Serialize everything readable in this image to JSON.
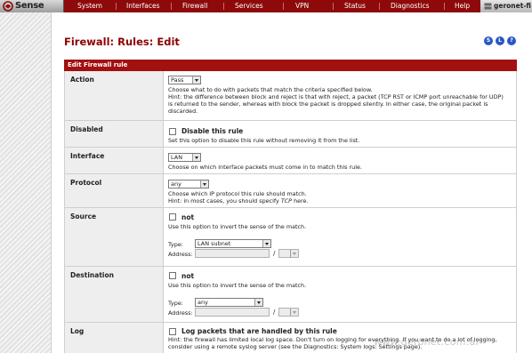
{
  "app": {
    "logo_text": "Sense",
    "hostname": "geronet-fi"
  },
  "nav": [
    "System",
    "Interfaces",
    "Firewall",
    "Services",
    "VPN",
    "Status",
    "Diagnostics",
    "Help"
  ],
  "page": {
    "title": "Firewall: Rules: Edit",
    "icons": [
      {
        "name": "status-icon",
        "letter": "S"
      },
      {
        "name": "log-icon",
        "letter": "L"
      },
      {
        "name": "help-icon",
        "letter": "?"
      }
    ]
  },
  "form": {
    "header": "Edit Firewall rule",
    "action": {
      "label": "Action",
      "value": "Pass",
      "desc": "Choose what to do with packets that match the criteria specified below.",
      "hint1": "Hint: the difference between block and reject is that with reject, a packet (TCP RST or ICMP port unreachable for UDP)",
      "hint2": "is returned to the sender, whereas with block the packet is dropped silently. In either case, the original packet is",
      "hint3": "discarded."
    },
    "disabled": {
      "label": "Disabled",
      "checkbox_label": "Disable this rule",
      "desc": "Set this option to disable this rule without removing it from the list."
    },
    "interface": {
      "label": "Interface",
      "value": "LAN",
      "desc": "Choose on which interface packets must come in to match this rule."
    },
    "protocol": {
      "label": "Protocol",
      "value": "any",
      "desc": "Choose which IP protocol this rule should match.",
      "hint_prefix": "Hint: in most cases, you should specify ",
      "hint_em": "TCP",
      "hint_suffix": " here."
    },
    "source": {
      "label": "Source",
      "not_label": "not",
      "desc": "Use this option to invert the sense of the match.",
      "type_label": "Type:",
      "type_value": "LAN subnet",
      "address_label": "Address:",
      "slash": "/"
    },
    "destination": {
      "label": "Destination",
      "not_label": "not",
      "desc": "Use this option to invert the sense of the match.",
      "type_label": "Type:",
      "type_value": "any",
      "address_label": "Address:",
      "slash": "/"
    },
    "log": {
      "label": "Log",
      "checkbox_label": "Log packets that are handled by this rule",
      "hint1": "Hint: the firewall has limited local log space. Don't turn on logging for everything. If you want to do a lot of logging,",
      "hint2": "consider using a remote syslog server (see the Diagnostics: System logs: Settings page)."
    }
  },
  "watermark": "www.geronet.com.ar",
  "colors": {
    "nav_bg": "#8e0a0a",
    "header_bg": "#a31010",
    "title": "#8e0000",
    "label_bg": "#eeeeee",
    "icon_blue": "#2a56c6"
  }
}
